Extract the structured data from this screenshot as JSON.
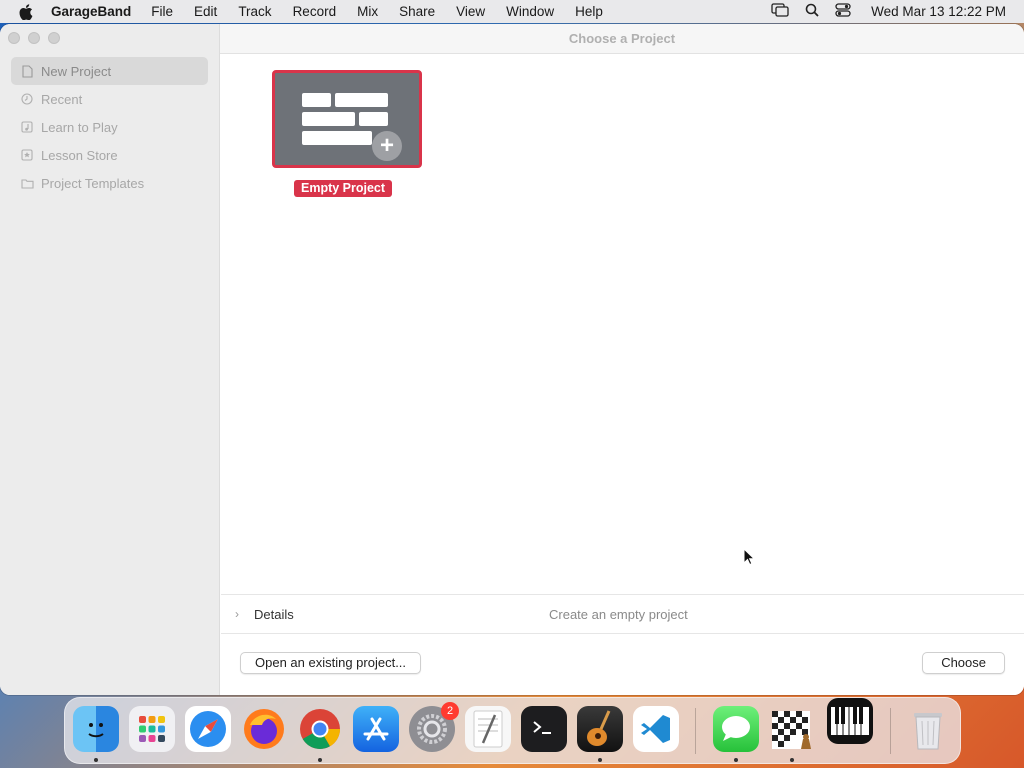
{
  "menubar": {
    "app_name": "GarageBand",
    "menus": [
      "File",
      "Edit",
      "Track",
      "Record",
      "Mix",
      "Share",
      "View",
      "Window",
      "Help"
    ],
    "clock": "Wed Mar 13  12:22 PM"
  },
  "window": {
    "title": "Choose a Project"
  },
  "sidebar": {
    "items": [
      {
        "label": "New Project",
        "icon": "document-icon",
        "selected": true
      },
      {
        "label": "Recent",
        "icon": "clock-icon",
        "selected": false
      },
      {
        "label": "Learn to Play",
        "icon": "music-note-icon",
        "selected": false
      },
      {
        "label": "Lesson Store",
        "icon": "star-icon",
        "selected": false
      },
      {
        "label": "Project Templates",
        "icon": "folder-icon",
        "selected": false
      }
    ]
  },
  "main": {
    "tile_label": "Empty Project",
    "details_label": "Details",
    "details_description": "Create an empty project",
    "open_button": "Open an existing project...",
    "choose_button": "Choose"
  },
  "dock": {
    "apps": [
      "Finder",
      "Launchpad",
      "Safari",
      "Firefox",
      "Chrome",
      "App Store",
      "System Settings",
      "TextEdit",
      "Terminal",
      "GarageBand",
      "VS Code",
      "Messages",
      "Chess",
      "Piano",
      "Trash"
    ],
    "settings_badge": "2"
  },
  "colors": {
    "accent": "#d9344a",
    "tile_bg": "#6e7278"
  }
}
